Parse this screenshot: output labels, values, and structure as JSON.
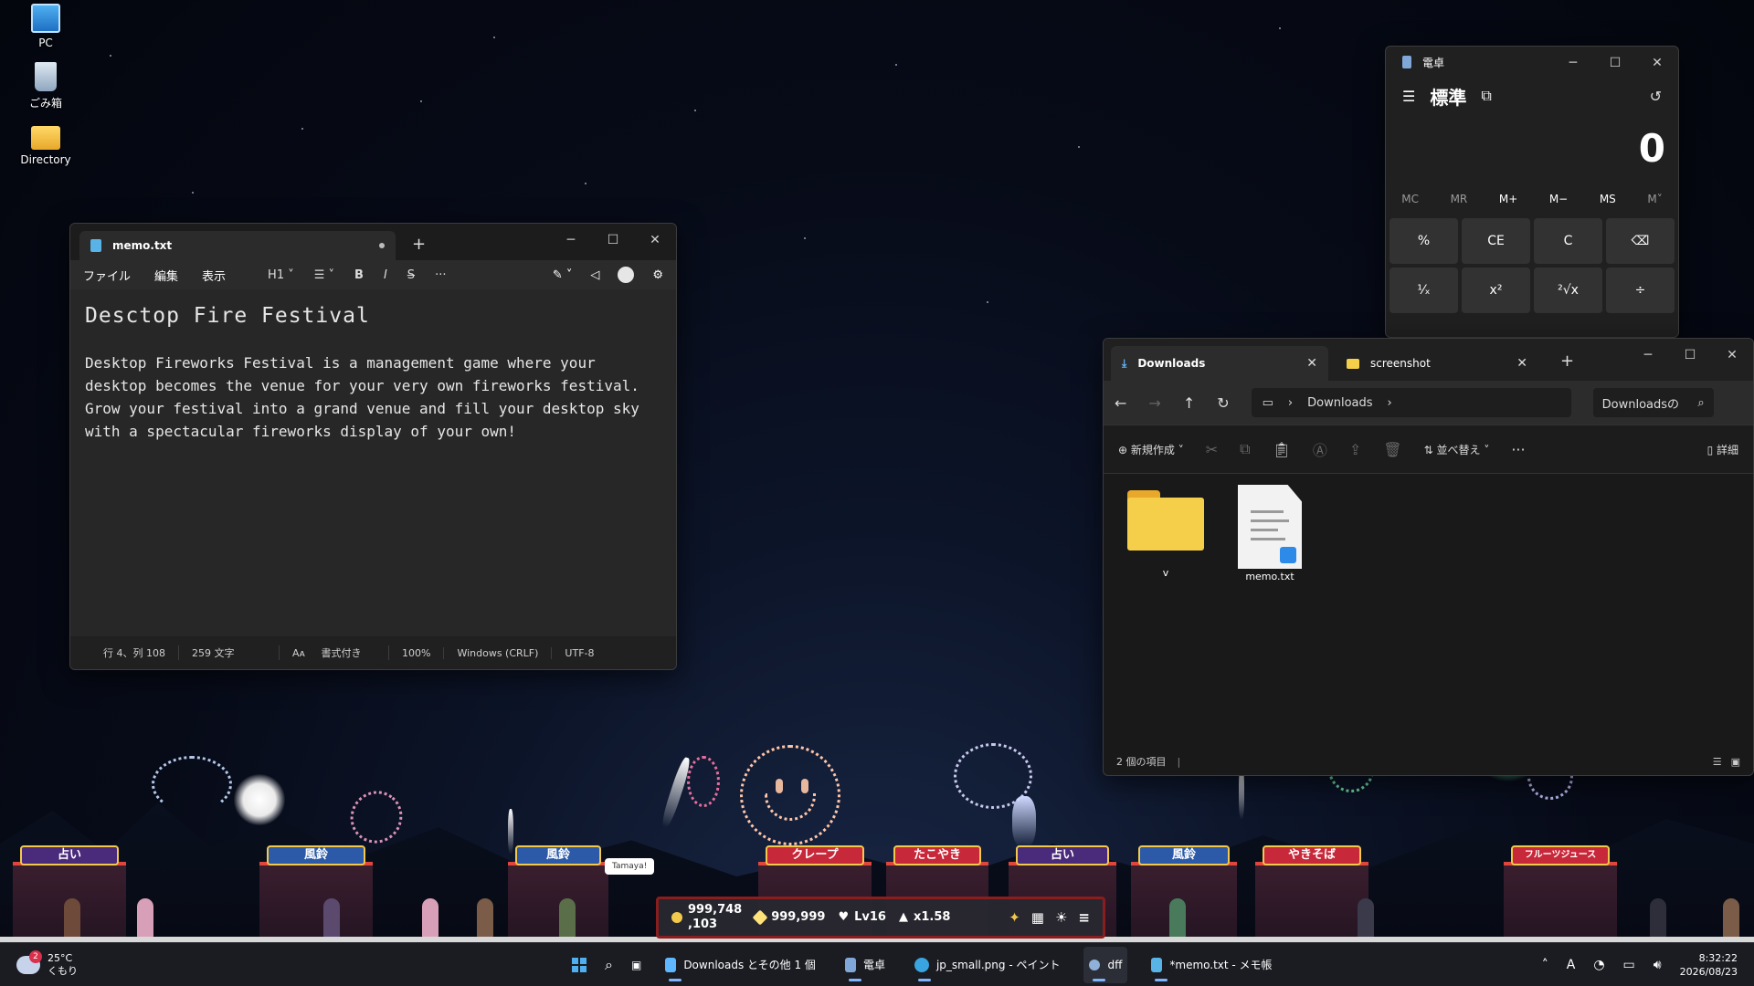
{
  "desktop": {
    "icons": [
      {
        "label": "PC",
        "icon": "monitor-icon"
      },
      {
        "label": "ごみ箱",
        "icon": "recycle-bin-icon"
      },
      {
        "label": "Directory",
        "icon": "folder-icon"
      }
    ]
  },
  "notepad": {
    "tab_title": "memo.txt",
    "menu": [
      "ファイル",
      "編集",
      "表示"
    ],
    "heading_selector": "H1",
    "content_title": "Desctop Fire Festival",
    "content_body": "Desktop Fireworks Festival is a management game where your desktop becomes the venue for your very own fireworks festival. Grow your festival into a grand venue and fill your desktop sky with a spectacular fireworks display of your own!",
    "status": {
      "position": "行 4、列 108",
      "chars": "259 文字",
      "format": "書式付き",
      "zoom": "100%",
      "line_ending": "Windows (CRLF)",
      "encoding": "UTF-8"
    }
  },
  "calculator": {
    "title": "電卓",
    "mode": "標準",
    "display": "0",
    "memory": [
      "MC",
      "MR",
      "M+",
      "M−",
      "MS",
      "M˅"
    ],
    "keys": [
      "%",
      "CE",
      "C",
      "⌫",
      "¹⁄ₓ",
      "x²",
      "²√x",
      "÷"
    ]
  },
  "explorer": {
    "tabs": [
      {
        "label": "Downloads"
      },
      {
        "label": "screenshot"
      }
    ],
    "address": "Downloads",
    "search_placeholder": "Downloadsの",
    "toolbar": {
      "new": "新規作成",
      "sort": "並べ替え",
      "details": "詳細"
    },
    "files": [
      {
        "name": "v",
        "type": "folder"
      },
      {
        "name": "memo.txt",
        "type": "text"
      }
    ],
    "status": "2 個の項目"
  },
  "festival": {
    "stall_signs": [
      "占い",
      "風鈴",
      "風鈴",
      "クレープ",
      "たこやき",
      "占い",
      "風鈴",
      "やきそば",
      "フルーツジュース"
    ],
    "speech_bubble": "Tamaya!",
    "hud": {
      "coins": "999,748\n,103",
      "stars": "999,999",
      "level": "Lv16",
      "multiplier": "x1.58"
    }
  },
  "taskbar": {
    "weather": {
      "temp": "25°C",
      "condition": "くもり",
      "badge": "2"
    },
    "apps": [
      {
        "label": "Downloads とその他 1 個",
        "icon": "file-explorer-icon",
        "color": "#f6cf4a"
      },
      {
        "label": "電卓",
        "icon": "calculator-icon",
        "color": "#3a6ea5"
      },
      {
        "label": "jp_small.png - ペイント",
        "icon": "paint-icon",
        "color": "#3aa4e0"
      },
      {
        "label": "dff",
        "icon": "game-icon",
        "color": "#8fb0d8"
      },
      {
        "label": "*memo.txt - メモ帳",
        "icon": "notepad-icon",
        "color": "#5ab3e6"
      }
    ],
    "clock": {
      "time": "8:32:22",
      "date": "2026/08/23"
    }
  }
}
